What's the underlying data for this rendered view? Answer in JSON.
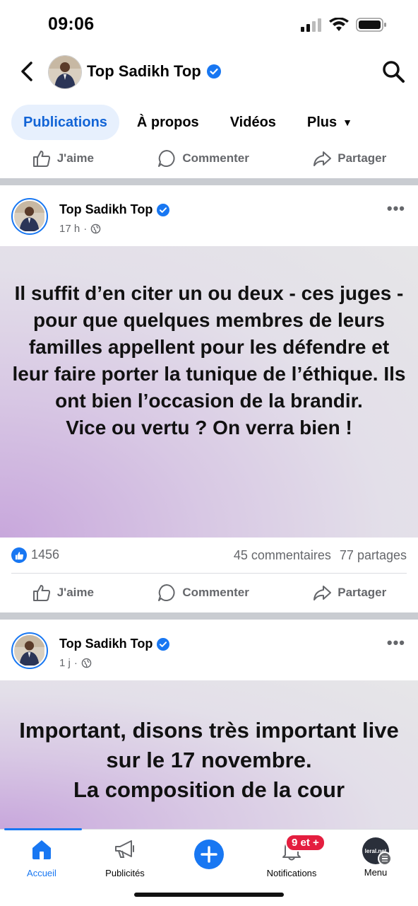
{
  "status_bar": {
    "time": "09:06"
  },
  "header": {
    "page_name": "Top Sadikh Top"
  },
  "tabs": [
    {
      "label": "Publications",
      "active": true
    },
    {
      "label": "À propos"
    },
    {
      "label": "Vidéos"
    },
    {
      "label": "Plus"
    }
  ],
  "actions": {
    "like": "J'aime",
    "comment": "Commenter",
    "share": "Partager"
  },
  "posts": [
    {
      "author": "Top Sadikh Top",
      "time": "17 h",
      "text": "Il suffit d’en citer un ou deux - ces juges - pour que quelques membres de leurs familles appellent pour les défendre et leur faire porter la tunique de l’éthique. Ils ont bien l’occasion de la brandir.\nVice ou vertu ? On verra bien !",
      "reactions": "1456",
      "comments": "45 commentaires",
      "shares": "77 partages"
    },
    {
      "author": "Top Sadikh Top",
      "time": "1 j",
      "text": "Important, disons très important live sur le 17 novembre.\nLa composition de la cour"
    }
  ],
  "bottom_nav": {
    "items": [
      {
        "label": "Accueil",
        "active": true
      },
      {
        "label": "Publicités"
      },
      {
        "label": ""
      },
      {
        "label": "Notifications"
      },
      {
        "label": "Menu"
      }
    ],
    "notification_badge": "9 et +",
    "menu_avatar_text": "leral.net"
  },
  "colors": {
    "accent": "#1877f2",
    "active_tab_bg": "#e7f0fd",
    "badge": "#e41e3f"
  }
}
